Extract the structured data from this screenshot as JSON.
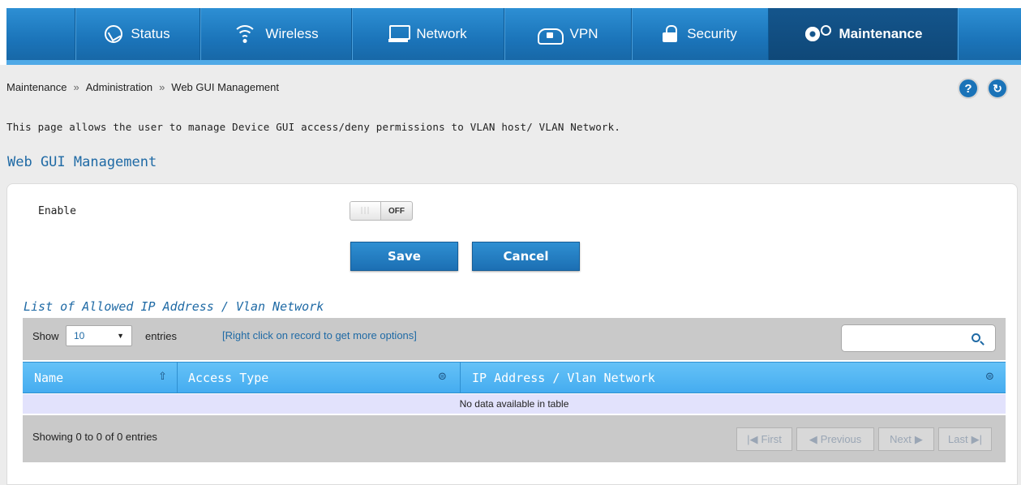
{
  "nav": {
    "items": [
      {
        "label": "Status",
        "icon": "dashboard-icon"
      },
      {
        "label": "Wireless",
        "icon": "wifi-icon"
      },
      {
        "label": "Network",
        "icon": "monitor-icon"
      },
      {
        "label": "VPN",
        "icon": "cloud-lock-icon"
      },
      {
        "label": "Security",
        "icon": "lock-icon"
      },
      {
        "label": "Maintenance",
        "icon": "gear-icon",
        "active": true
      }
    ]
  },
  "breadcrumb": {
    "items": [
      "Maintenance",
      "Administration",
      "Web GUI Management"
    ],
    "separator": "»"
  },
  "header_buttons": {
    "help": "?",
    "refresh": "↻"
  },
  "description": "This page allows the user to manage Device GUI access/deny permissions to VLAN host/ VLAN Network.",
  "section_title": "Web GUI Management",
  "form": {
    "enable_label": "Enable",
    "enable_state": "OFF",
    "toggle_grip": "|||",
    "save_label": "Save",
    "cancel_label": "Cancel"
  },
  "list": {
    "title": "List of Allowed IP Address / Vlan Network",
    "show_label": "Show",
    "page_size": "10",
    "entries_label": "entries",
    "hint": "[Right click on record to get more options]",
    "search_value": "",
    "columns": [
      "Name",
      "Access Type",
      "IP Address / Vlan Network"
    ],
    "empty_message": "No data available in table",
    "info": "Showing 0 to 0 of 0 entries",
    "pagination": {
      "first": "First",
      "previous": "Previous",
      "next": "Next",
      "last": "Last"
    }
  },
  "colors": {
    "nav_blue": "#1b74b9",
    "accent_blue": "#1f6aa5",
    "table_header": "#4fb5f4",
    "empty_row": "#e2e2fc"
  }
}
